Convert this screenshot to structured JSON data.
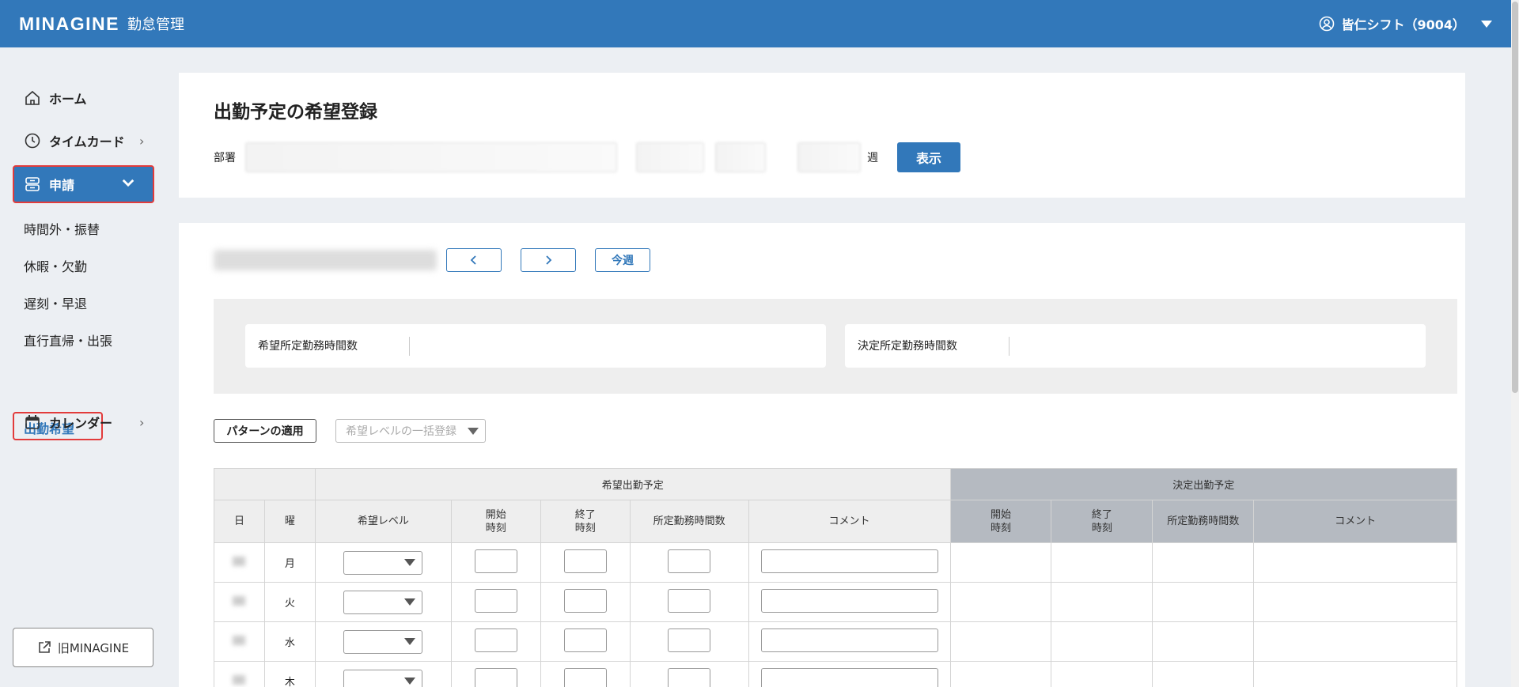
{
  "header": {
    "brand": "MINAGINE",
    "brand_sub": "勤怠管理",
    "user_name": "皆仁シフト（9004）"
  },
  "sidebar": {
    "home": "ホーム",
    "timecard": "タイムカード",
    "request": "申請",
    "sub_items": [
      "時間外・振替",
      "休暇・欠勤",
      "遅刻・早退",
      "直行直帰・出張"
    ],
    "active_sub": "出勤希望",
    "calendar": "カレンダー",
    "old_link": "旧MINAGINE"
  },
  "page": {
    "title": "出勤予定の希望登録",
    "dept_label": "部署",
    "week_label": "週",
    "show_button": "表示",
    "today_button": "今週",
    "prev_icon": "chevron-left-icon",
    "next_icon": "chevron-right-icon"
  },
  "summary": {
    "requested_hours_label": "希望所定勤務時間数",
    "decided_hours_label": "決定所定勤務時間数"
  },
  "tools": {
    "pattern_button": "パターンの適用",
    "bulk_placeholder": "希望レベルの一括登録"
  },
  "table": {
    "group_requested": "希望出勤予定",
    "group_decided": "決定出勤予定",
    "col_day": "日",
    "col_weekday": "曜",
    "col_level": "希望レベル",
    "col_start": "開始\n時刻",
    "col_end": "終了\n時刻",
    "col_hours": "所定勤務時間数",
    "col_comment": "コメント",
    "weekdays": [
      "月",
      "火",
      "水",
      "木"
    ]
  },
  "colors": {
    "primary": "#3278ba",
    "highlight": "#e23b3b",
    "decided_header": "#b5bac1"
  }
}
